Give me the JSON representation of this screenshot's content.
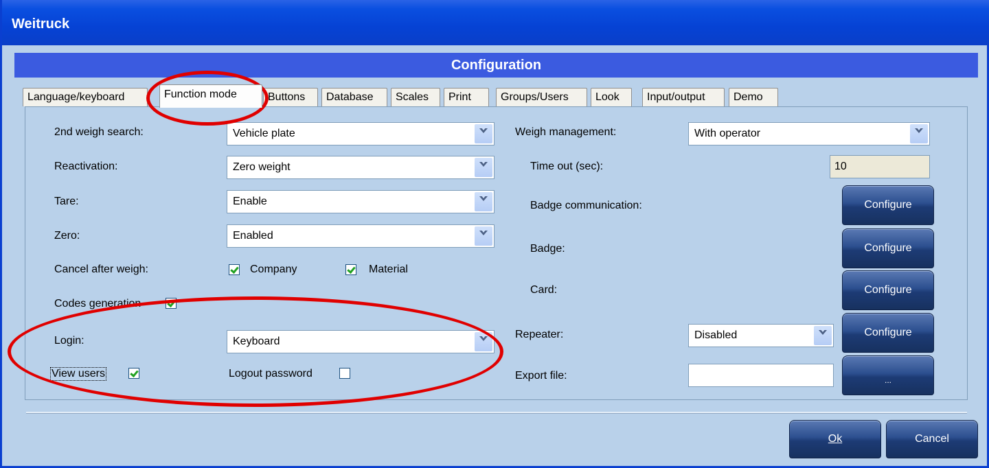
{
  "window": {
    "title": "Weitruck"
  },
  "banner": {
    "title": "Configuration"
  },
  "tabs": [
    {
      "label": "Language/keyboard"
    },
    {
      "label": "Function mode"
    },
    {
      "label": "Buttons"
    },
    {
      "label": "Database"
    },
    {
      "label": "Scales"
    },
    {
      "label": "Print"
    },
    {
      "label": "Groups/Users"
    },
    {
      "label": "Look"
    },
    {
      "label": "Input/output"
    },
    {
      "label": "Demo"
    }
  ],
  "left": {
    "second_weigh_search": {
      "label": "2nd weigh search:",
      "value": "Vehicle plate"
    },
    "reactivation": {
      "label": "Reactivation:",
      "value": "Zero weight"
    },
    "tare": {
      "label": "Tare:",
      "value": "Enable"
    },
    "zero": {
      "label": "Zero:",
      "value": "Enabled"
    },
    "cancel_after_weigh": {
      "label": "Cancel after weigh:",
      "company": "Company",
      "material": "Material",
      "company_checked": true,
      "material_checked": true
    },
    "codes_generation": {
      "label": "Codes generation",
      "checked": true
    },
    "login": {
      "label": "Login:",
      "value": "Keyboard"
    },
    "view_users": {
      "label": "View users",
      "checked": true
    },
    "logout_password": {
      "label": "Logout password",
      "checked": false
    }
  },
  "right": {
    "weigh_management": {
      "label": "Weigh management:",
      "value": "With operator"
    },
    "time_out": {
      "label": "Time out (sec):",
      "value": "10"
    },
    "badge_communication": {
      "label": "Badge communication:",
      "button": "Configure"
    },
    "badge": {
      "label": "Badge:",
      "button": "Configure"
    },
    "card": {
      "label": "Card:",
      "button": "Configure"
    },
    "repeater": {
      "label": "Repeater:",
      "value": "Disabled",
      "button": "Configure"
    },
    "export_file": {
      "label": "Export file:",
      "value": "",
      "button": "..."
    }
  },
  "footer": {
    "ok": "Ok",
    "cancel": "Cancel"
  },
  "colors": {
    "titlebar": "#0642d4",
    "banner": "#3b5be0",
    "panel": "#b9d1ea",
    "annotation": "#e00000"
  }
}
